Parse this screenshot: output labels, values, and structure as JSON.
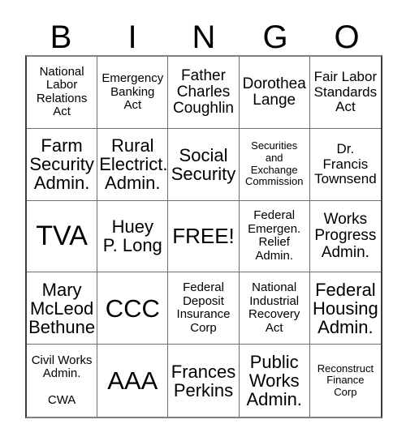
{
  "card": {
    "title": "Bingo Card",
    "header_letters": [
      "B",
      "I",
      "N",
      "G",
      "O"
    ],
    "columns": 5,
    "rows": 5,
    "free_space_index": 12,
    "colors": {
      "background": "#ffffff",
      "text": "#000000",
      "grid_line": "#6e6e6e",
      "grid_border": "#3a3a3a"
    },
    "cells": [
      {
        "text": "National\nLabor\nRelations\nAct",
        "size": "sz-s"
      },
      {
        "text": "Emergency\nBanking\nAct",
        "size": "sz-s"
      },
      {
        "text": "Father\nCharles\nCoughlin",
        "size": "sz-l"
      },
      {
        "text": "Dorothea\nLange",
        "size": "sz-l"
      },
      {
        "text": "Fair Labor\nStandards\nAct",
        "size": "sz-m"
      },
      {
        "text": "Farm\nSecurity\nAdmin.",
        "size": "sz-xl"
      },
      {
        "text": "Rural\nElectrict.\nAdmin.",
        "size": "sz-xl"
      },
      {
        "text": "Social\nSecurity",
        "size": "sz-xl"
      },
      {
        "text": "Securities\nand\nExchange\nCommission",
        "size": "sz-xs"
      },
      {
        "text": "Dr.\nFrancis\nTownsend",
        "size": "sz-m"
      },
      {
        "text": "TVA",
        "size": "sz-h1"
      },
      {
        "text": "Huey\nP. Long",
        "size": "sz-xl"
      },
      {
        "text": "FREE!",
        "size": "sz-xxl"
      },
      {
        "text": "Federal\nEmergen.\nRelief\nAdmin.",
        "size": "sz-s"
      },
      {
        "text": "Works\nProgress\nAdmin.",
        "size": "sz-l"
      },
      {
        "text": "Mary\nMcLeod\nBethune",
        "size": "sz-xl"
      },
      {
        "text": "CCC",
        "size": "sz-h2"
      },
      {
        "text": "Federal\nDeposit\nInsurance\nCorp",
        "size": "sz-s"
      },
      {
        "text": "National\nIndustrial\nRecovery\nAct",
        "size": "sz-s"
      },
      {
        "text": "Federal\nHousing\nAdmin.",
        "size": "sz-xl"
      },
      {
        "text": "Civil Works\nAdmin.\n\nCWA",
        "size": "sz-s"
      },
      {
        "text": "AAA",
        "size": "sz-h2"
      },
      {
        "text": "Frances\nPerkins",
        "size": "sz-xl"
      },
      {
        "text": "Public\nWorks\nAdmin.",
        "size": "sz-xl"
      },
      {
        "text": "Reconstruct\nFinance\nCorp",
        "size": "sz-xs"
      }
    ]
  }
}
